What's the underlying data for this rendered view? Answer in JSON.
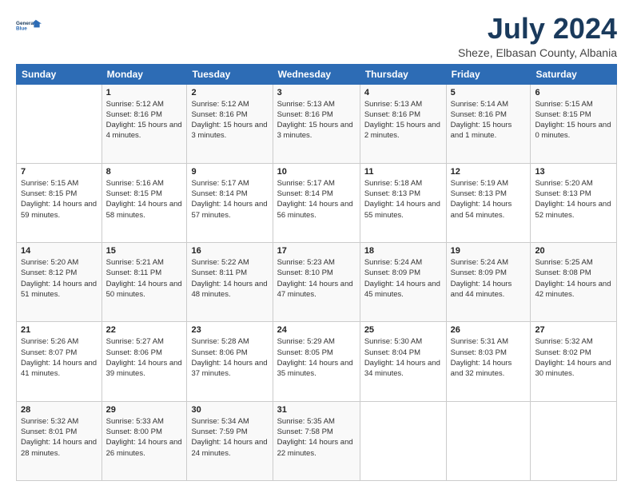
{
  "logo": {
    "line1": "General",
    "line2": "Blue"
  },
  "title": "July 2024",
  "subtitle": "Sheze, Elbasan County, Albania",
  "days_header": [
    "Sunday",
    "Monday",
    "Tuesday",
    "Wednesday",
    "Thursday",
    "Friday",
    "Saturday"
  ],
  "weeks": [
    [
      {
        "day": "",
        "sunrise": "",
        "sunset": "",
        "daylight": ""
      },
      {
        "day": "1",
        "sunrise": "Sunrise: 5:12 AM",
        "sunset": "Sunset: 8:16 PM",
        "daylight": "Daylight: 15 hours and 4 minutes."
      },
      {
        "day": "2",
        "sunrise": "Sunrise: 5:12 AM",
        "sunset": "Sunset: 8:16 PM",
        "daylight": "Daylight: 15 hours and 3 minutes."
      },
      {
        "day": "3",
        "sunrise": "Sunrise: 5:13 AM",
        "sunset": "Sunset: 8:16 PM",
        "daylight": "Daylight: 15 hours and 3 minutes."
      },
      {
        "day": "4",
        "sunrise": "Sunrise: 5:13 AM",
        "sunset": "Sunset: 8:16 PM",
        "daylight": "Daylight: 15 hours and 2 minutes."
      },
      {
        "day": "5",
        "sunrise": "Sunrise: 5:14 AM",
        "sunset": "Sunset: 8:16 PM",
        "daylight": "Daylight: 15 hours and 1 minute."
      },
      {
        "day": "6",
        "sunrise": "Sunrise: 5:15 AM",
        "sunset": "Sunset: 8:15 PM",
        "daylight": "Daylight: 15 hours and 0 minutes."
      }
    ],
    [
      {
        "day": "7",
        "sunrise": "Sunrise: 5:15 AM",
        "sunset": "Sunset: 8:15 PM",
        "daylight": "Daylight: 14 hours and 59 minutes."
      },
      {
        "day": "8",
        "sunrise": "Sunrise: 5:16 AM",
        "sunset": "Sunset: 8:15 PM",
        "daylight": "Daylight: 14 hours and 58 minutes."
      },
      {
        "day": "9",
        "sunrise": "Sunrise: 5:17 AM",
        "sunset": "Sunset: 8:14 PM",
        "daylight": "Daylight: 14 hours and 57 minutes."
      },
      {
        "day": "10",
        "sunrise": "Sunrise: 5:17 AM",
        "sunset": "Sunset: 8:14 PM",
        "daylight": "Daylight: 14 hours and 56 minutes."
      },
      {
        "day": "11",
        "sunrise": "Sunrise: 5:18 AM",
        "sunset": "Sunset: 8:13 PM",
        "daylight": "Daylight: 14 hours and 55 minutes."
      },
      {
        "day": "12",
        "sunrise": "Sunrise: 5:19 AM",
        "sunset": "Sunset: 8:13 PM",
        "daylight": "Daylight: 14 hours and 54 minutes."
      },
      {
        "day": "13",
        "sunrise": "Sunrise: 5:20 AM",
        "sunset": "Sunset: 8:13 PM",
        "daylight": "Daylight: 14 hours and 52 minutes."
      }
    ],
    [
      {
        "day": "14",
        "sunrise": "Sunrise: 5:20 AM",
        "sunset": "Sunset: 8:12 PM",
        "daylight": "Daylight: 14 hours and 51 minutes."
      },
      {
        "day": "15",
        "sunrise": "Sunrise: 5:21 AM",
        "sunset": "Sunset: 8:11 PM",
        "daylight": "Daylight: 14 hours and 50 minutes."
      },
      {
        "day": "16",
        "sunrise": "Sunrise: 5:22 AM",
        "sunset": "Sunset: 8:11 PM",
        "daylight": "Daylight: 14 hours and 48 minutes."
      },
      {
        "day": "17",
        "sunrise": "Sunrise: 5:23 AM",
        "sunset": "Sunset: 8:10 PM",
        "daylight": "Daylight: 14 hours and 47 minutes."
      },
      {
        "day": "18",
        "sunrise": "Sunrise: 5:24 AM",
        "sunset": "Sunset: 8:09 PM",
        "daylight": "Daylight: 14 hours and 45 minutes."
      },
      {
        "day": "19",
        "sunrise": "Sunrise: 5:24 AM",
        "sunset": "Sunset: 8:09 PM",
        "daylight": "Daylight: 14 hours and 44 minutes."
      },
      {
        "day": "20",
        "sunrise": "Sunrise: 5:25 AM",
        "sunset": "Sunset: 8:08 PM",
        "daylight": "Daylight: 14 hours and 42 minutes."
      }
    ],
    [
      {
        "day": "21",
        "sunrise": "Sunrise: 5:26 AM",
        "sunset": "Sunset: 8:07 PM",
        "daylight": "Daylight: 14 hours and 41 minutes."
      },
      {
        "day": "22",
        "sunrise": "Sunrise: 5:27 AM",
        "sunset": "Sunset: 8:06 PM",
        "daylight": "Daylight: 14 hours and 39 minutes."
      },
      {
        "day": "23",
        "sunrise": "Sunrise: 5:28 AM",
        "sunset": "Sunset: 8:06 PM",
        "daylight": "Daylight: 14 hours and 37 minutes."
      },
      {
        "day": "24",
        "sunrise": "Sunrise: 5:29 AM",
        "sunset": "Sunset: 8:05 PM",
        "daylight": "Daylight: 14 hours and 35 minutes."
      },
      {
        "day": "25",
        "sunrise": "Sunrise: 5:30 AM",
        "sunset": "Sunset: 8:04 PM",
        "daylight": "Daylight: 14 hours and 34 minutes."
      },
      {
        "day": "26",
        "sunrise": "Sunrise: 5:31 AM",
        "sunset": "Sunset: 8:03 PM",
        "daylight": "Daylight: 14 hours and 32 minutes."
      },
      {
        "day": "27",
        "sunrise": "Sunrise: 5:32 AM",
        "sunset": "Sunset: 8:02 PM",
        "daylight": "Daylight: 14 hours and 30 minutes."
      }
    ],
    [
      {
        "day": "28",
        "sunrise": "Sunrise: 5:32 AM",
        "sunset": "Sunset: 8:01 PM",
        "daylight": "Daylight: 14 hours and 28 minutes."
      },
      {
        "day": "29",
        "sunrise": "Sunrise: 5:33 AM",
        "sunset": "Sunset: 8:00 PM",
        "daylight": "Daylight: 14 hours and 26 minutes."
      },
      {
        "day": "30",
        "sunrise": "Sunrise: 5:34 AM",
        "sunset": "Sunset: 7:59 PM",
        "daylight": "Daylight: 14 hours and 24 minutes."
      },
      {
        "day": "31",
        "sunrise": "Sunrise: 5:35 AM",
        "sunset": "Sunset: 7:58 PM",
        "daylight": "Daylight: 14 hours and 22 minutes."
      },
      {
        "day": "",
        "sunrise": "",
        "sunset": "",
        "daylight": ""
      },
      {
        "day": "",
        "sunrise": "",
        "sunset": "",
        "daylight": ""
      },
      {
        "day": "",
        "sunrise": "",
        "sunset": "",
        "daylight": ""
      }
    ]
  ]
}
